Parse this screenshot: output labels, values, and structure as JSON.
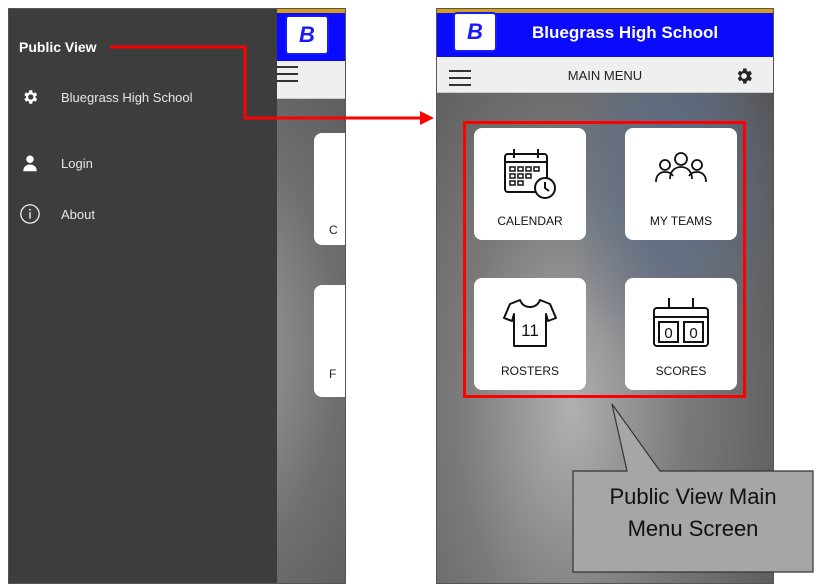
{
  "left_screen": {
    "logo_text": "B",
    "drawer": {
      "title": "Public View",
      "items": [
        {
          "label": "Bluegrass High School",
          "icon": "gear-icon"
        },
        {
          "label": "Login",
          "icon": "user-icon"
        },
        {
          "label": "About",
          "icon": "info-icon"
        }
      ]
    },
    "peek_letters": [
      "C",
      "F"
    ]
  },
  "right_screen": {
    "logo_text": "B",
    "school_name": "Bluegrass High School",
    "menu_title": "MAIN MENU",
    "tiles": [
      {
        "label": "CALENDAR",
        "icon": "calendar-icon"
      },
      {
        "label": "MY TEAMS",
        "icon": "team-icon"
      },
      {
        "label": "ROSTERS",
        "icon": "jersey-icon"
      },
      {
        "label": "SCORES",
        "icon": "scoreboard-icon"
      }
    ],
    "jersey_number": "11",
    "score_digits": [
      "0",
      "0"
    ]
  },
  "callout": {
    "line1": "Public View Main",
    "line2": "Menu Screen"
  },
  "colors": {
    "header_blue": "#0a0aff",
    "gold_stripe": "#d4a017",
    "drawer_bg": "#3d3d3d",
    "annotation_red": "#ff0000",
    "callout_bg": "#a6a6a6"
  }
}
